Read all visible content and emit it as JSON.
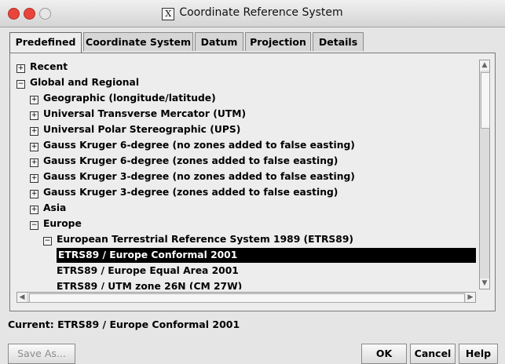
{
  "window": {
    "title": "Coordinate Reference System",
    "title_icon": "x11-icon"
  },
  "tabs": [
    {
      "label": "Predefined",
      "active": true
    },
    {
      "label": "Coordinate System",
      "active": false
    },
    {
      "label": "Datum",
      "active": false
    },
    {
      "label": "Projection",
      "active": false
    },
    {
      "label": "Details",
      "active": false
    }
  ],
  "tree": [
    {
      "label": "Recent",
      "expander": "⊞",
      "level": 0,
      "selected": false
    },
    {
      "label": "Global and Regional",
      "expander": "⊟",
      "level": 0,
      "selected": false
    },
    {
      "label": "Geographic (longitude/latitude)",
      "expander": "⊞",
      "level": 1,
      "selected": false
    },
    {
      "label": "Universal Transverse Mercator (UTM)",
      "expander": "⊞",
      "level": 1,
      "selected": false
    },
    {
      "label": "Universal Polar Stereographic (UPS)",
      "expander": "⊞",
      "level": 1,
      "selected": false
    },
    {
      "label": "Gauss Kruger 6-degree (no zones added to false easting)",
      "expander": "⊞",
      "level": 1,
      "selected": false
    },
    {
      "label": "Gauss Kruger 6-degree (zones added to false easting)",
      "expander": "⊞",
      "level": 1,
      "selected": false
    },
    {
      "label": "Gauss Kruger 3-degree (no zones added to false easting)",
      "expander": "⊞",
      "level": 1,
      "selected": false
    },
    {
      "label": "Gauss Kruger 3-degree (zones added to false easting)",
      "expander": "⊞",
      "level": 1,
      "selected": false
    },
    {
      "label": "Asia",
      "expander": "⊞",
      "level": 1,
      "selected": false
    },
    {
      "label": "Europe",
      "expander": "⊟",
      "level": 1,
      "selected": false
    },
    {
      "label": "European Terrestrial Reference System 1989 (ETRS89)",
      "expander": "⊟",
      "level": 2,
      "selected": false
    },
    {
      "label": "ETRS89 / Europe Conformal 2001",
      "expander": "",
      "level": 3,
      "selected": true
    },
    {
      "label": "ETRS89 / Europe Equal Area 2001",
      "expander": "",
      "level": 3,
      "selected": false
    },
    {
      "label": "ETRS89 / UTM zone 26N (CM 27W)",
      "expander": "",
      "level": 3,
      "selected": false
    }
  ],
  "status": {
    "current": "Current: ETRS89 / Europe Conformal 2001"
  },
  "buttons": {
    "save_as": "Save As...",
    "ok": "OK",
    "cancel": "Cancel",
    "help": "Help"
  },
  "colors": {
    "selection": "#000000",
    "close": "#e8463c"
  }
}
